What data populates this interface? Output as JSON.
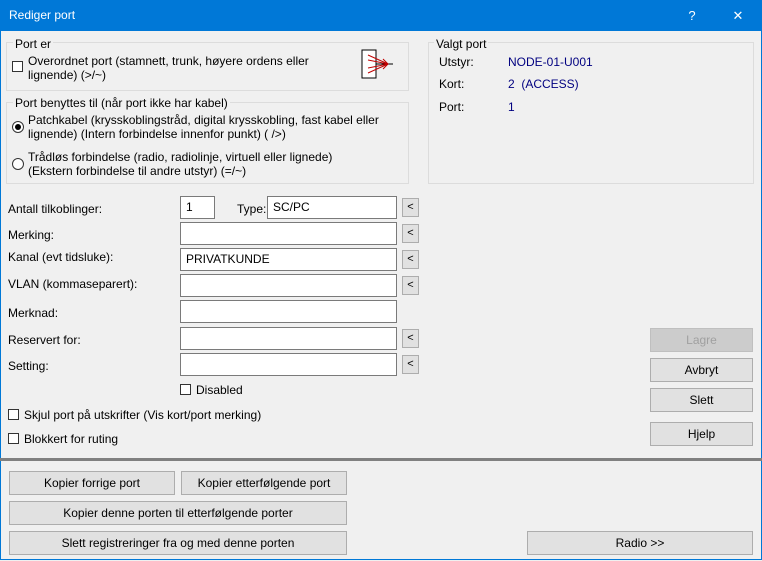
{
  "window": {
    "title": "Rediger port",
    "help_glyph": "?",
    "close_glyph": "✕"
  },
  "port_er": {
    "legend": "Port er",
    "overordnet": {
      "line1": "Overordnet port (stamnett, trunk, høyere ordens eller",
      "line2": "lignende) (>/~)",
      "checked": false
    }
  },
  "port_benyttes": {
    "legend": "Port benyttes til (når port ikke har kabel)",
    "patch": {
      "line1": "Patchkabel (krysskoblingstråd, digital krysskobling, fast kabel eller",
      "line2": "lignende) (Intern forbindelse innenfor punkt) ( />)",
      "selected": true
    },
    "wireless": {
      "line1": "Trådløs forbindelse (radio, radiolinje, virtuell eller lignede)",
      "line2": "(Ekstern forbindelse til andre utstyr) (=/~)",
      "selected": false
    }
  },
  "valgt_port": {
    "legend": "Valgt port",
    "utstyr_label": "Utstyr:",
    "utstyr_value": "NODE-01-U001",
    "kort_label": "Kort:",
    "kort_value": "2  (ACCESS)",
    "port_label": "Port:",
    "port_value": "1"
  },
  "form": {
    "antall_label": "Antall tilkoblinger:",
    "antall_value": "1",
    "type_label": "Type:",
    "type_value": "SC/PC",
    "merking_label": "Merking:",
    "merking_value": "",
    "kanal_label": "Kanal (evt tidsluke):",
    "kanal_value": "PRIVATKUNDE",
    "vlan_label": "VLAN (kommaseparert):",
    "vlan_value": "",
    "merknad_label": "Merknad:",
    "merknad_value": "",
    "reservert_label": "Reservert for:",
    "reservert_value": "",
    "setting_label": "Setting:",
    "setting_value": "",
    "pick_glyph": "<",
    "disabled_label": "Disabled"
  },
  "options": {
    "skjul_label": "Skjul port på utskrifter (Vis kort/port merking)",
    "blokkert_label": "Blokkert for ruting"
  },
  "actions": {
    "lagre": "Lagre",
    "avbryt": "Avbryt",
    "slett": "Slett",
    "hjelp": "Hjelp"
  },
  "bottom": {
    "kopier_forrige": "Kopier forrige port",
    "kopier_etterfolgende": "Kopier etterfølgende port",
    "kopier_denne": "Kopier denne porten til etterfølgende porter",
    "slett_reg": "Slett registreringer fra og med denne porten",
    "radio": "Radio >>"
  },
  "colors": {
    "titlebar": "#0078d7",
    "value_text": "#000080",
    "icon_arrows": "#c00000"
  }
}
